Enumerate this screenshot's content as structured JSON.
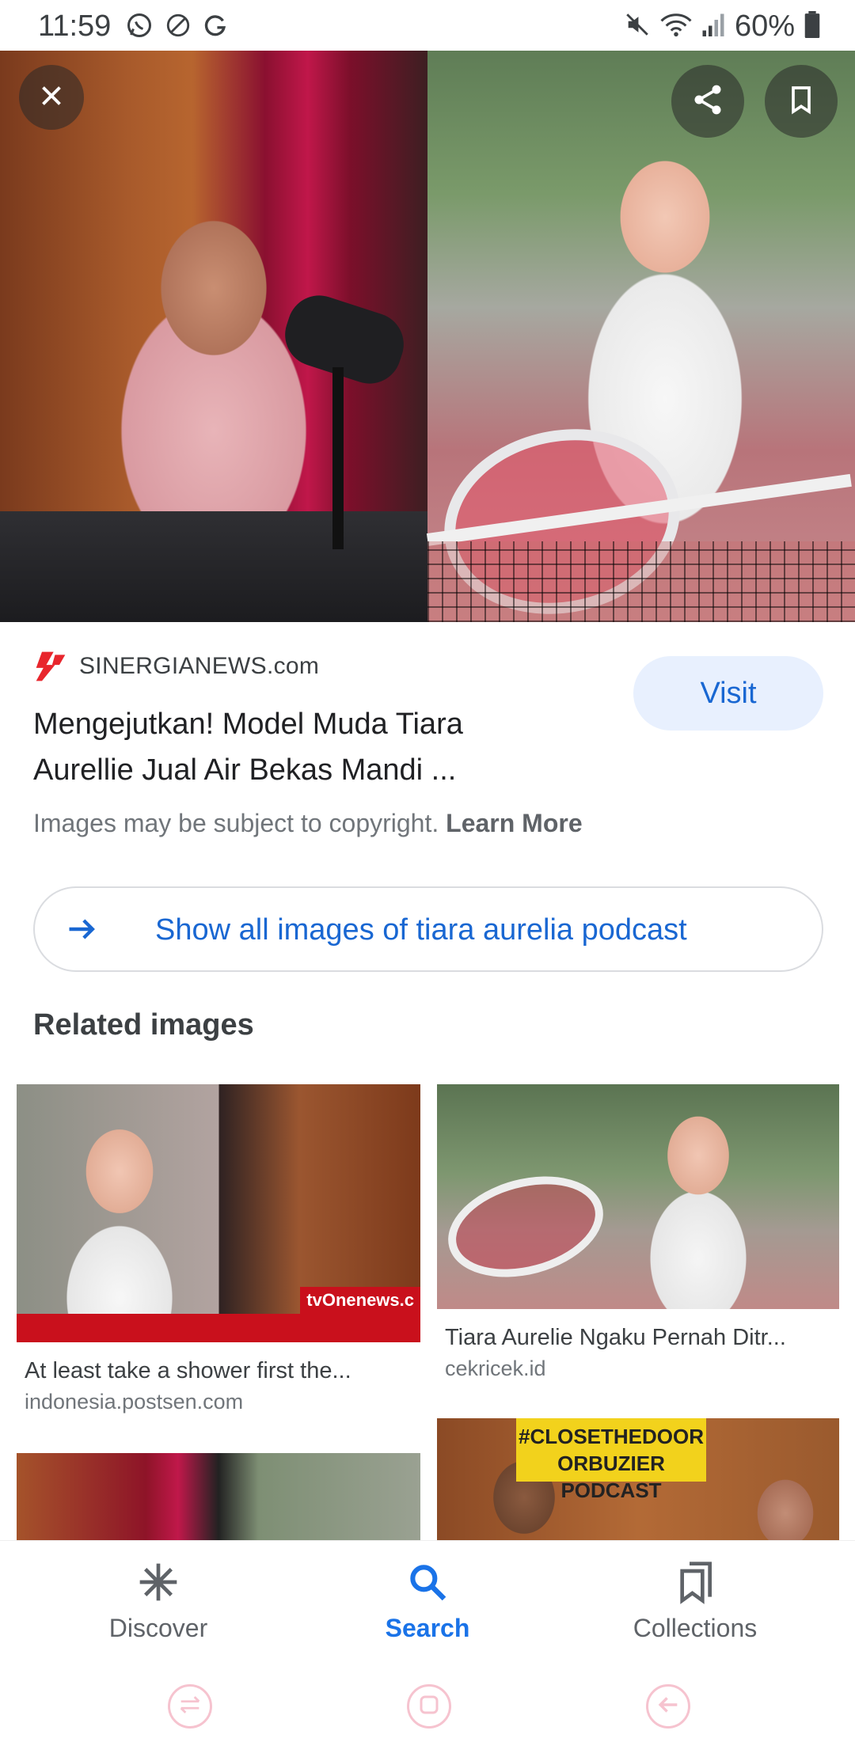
{
  "status_bar": {
    "time": "11:59",
    "battery": "60%",
    "left_icons": [
      "whatsapp-icon",
      "do-not-disturb-icon",
      "grammarly-icon"
    ],
    "right_icons": [
      "mute-icon",
      "wifi-icon",
      "signal-icon",
      "battery-icon"
    ]
  },
  "viewer": {
    "buttons": [
      "close-icon",
      "share-icon",
      "bookmark-icon"
    ]
  },
  "result": {
    "source": "SINERGIANEWS.com",
    "title_line1": "Mengejutkan! Model Muda Tiara",
    "title_line2": "Aurellie Jual Air Bekas Mandi ...",
    "visit_label": "Visit",
    "copyright_text": "Images may be subject to copyright.",
    "learn_more": "Learn More"
  },
  "show_all": {
    "label": "Show all images of tiara aurelia podcast"
  },
  "related": {
    "heading": "Related images",
    "items": [
      {
        "title": "At least take a shower first the...",
        "source": "indonesia.postsen.com",
        "logo_text": "tvOnenews.c"
      },
      {
        "title": "Tiara Aurelie Ngaku Pernah Ditr...",
        "source": "cekricek.id"
      },
      {
        "banner_text": "#CLOSETHEDOOR ORBUZIER PODCAST"
      }
    ]
  },
  "bottom_nav": {
    "items": [
      {
        "label": "Discover",
        "icon": "asterisk-icon"
      },
      {
        "label": "Search",
        "icon": "search-icon",
        "active": true
      },
      {
        "label": "Collections",
        "icon": "collections-icon"
      }
    ]
  },
  "colors": {
    "accent": "#1a73e8",
    "visit_bg": "#e8f0fe",
    "text": "#202124",
    "muted": "#70757a",
    "source_logo": "#e8262d"
  }
}
